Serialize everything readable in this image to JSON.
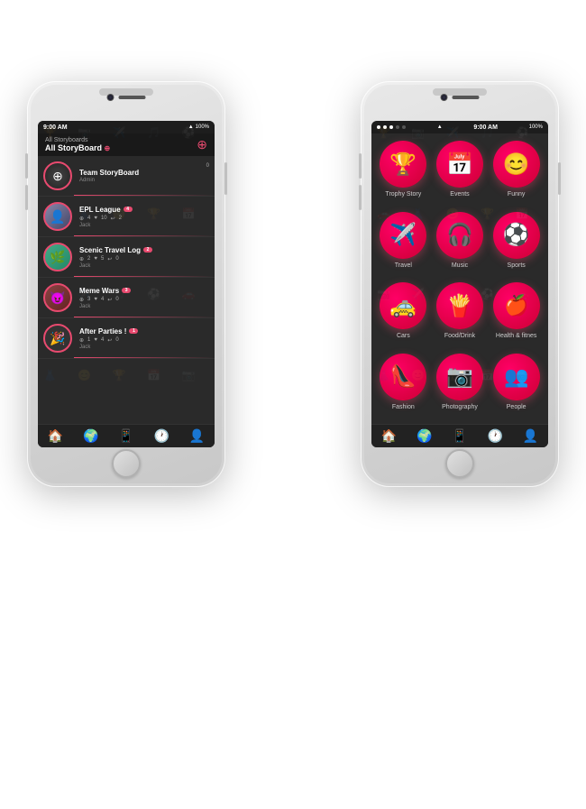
{
  "scene": {
    "background": "white"
  },
  "left_phone": {
    "status_bar": {
      "time": "9:00 AM",
      "battery": "100%",
      "signal": "●●●",
      "wifi": "▲"
    },
    "header": {
      "subtitle": "All Storyboards",
      "title": "All StoryBoard",
      "title_badge": "⊕"
    },
    "stories": [
      {
        "name": "Team StoryBoard",
        "badge": "",
        "author": "Admin",
        "actions": [],
        "add_count": "0",
        "avatar_type": "team"
      },
      {
        "name": "EPL League",
        "badge": "4",
        "author": "Jack",
        "add": "4",
        "like": "10",
        "share": "2",
        "avatar_type": "epl"
      },
      {
        "name": "Scenic Travel Log",
        "badge": "2",
        "author": "Jack",
        "add": "2",
        "like": "5",
        "share": "0",
        "avatar_type": "travel"
      },
      {
        "name": "Meme Wars",
        "badge": "3",
        "author": "Jack",
        "add": "3",
        "like": "4",
        "share": "0",
        "avatar_type": "meme"
      },
      {
        "name": "After Parties !",
        "badge": "1",
        "author": "Jack",
        "add": "1",
        "like": "4",
        "share": "0",
        "avatar_type": "party"
      }
    ],
    "bottom_nav": [
      "🏠",
      "🌍",
      "📱",
      "🕐",
      "👤"
    ]
  },
  "right_phone": {
    "status_bar": {
      "time": "9:00 AM",
      "battery": "100%",
      "dots": "●●●○○"
    },
    "categories": [
      {
        "label": "Trophy Story",
        "emoji": "🏆",
        "color": "#e84a6f"
      },
      {
        "label": "Events",
        "emoji": "📅",
        "color": "#e84a6f"
      },
      {
        "label": "Funny",
        "emoji": "😊",
        "color": "#e84a6f"
      },
      {
        "label": "Travel",
        "emoji": "✈️",
        "color": "#e84a6f"
      },
      {
        "label": "Music",
        "emoji": "🎧",
        "color": "#e84a6f"
      },
      {
        "label": "Sports",
        "emoji": "⚽",
        "color": "#e84a6f"
      },
      {
        "label": "Cars",
        "emoji": "🚕",
        "color": "#e84a6f"
      },
      {
        "label": "Food/Drink",
        "emoji": "🍟",
        "color": "#e84a6f"
      },
      {
        "label": "Health & fitnes",
        "emoji": "🍎",
        "color": "#e84a6f"
      },
      {
        "label": "Fashion",
        "emoji": "👠",
        "color": "#e84a6f"
      },
      {
        "label": "Photography",
        "emoji": "📷",
        "color": "#e84a6f"
      },
      {
        "label": "People",
        "emoji": "👥",
        "color": "#e84a6f"
      }
    ],
    "bottom_nav": [
      "🏠",
      "🌍",
      "📱",
      "🕐",
      "👤"
    ],
    "active_nav": 1
  }
}
